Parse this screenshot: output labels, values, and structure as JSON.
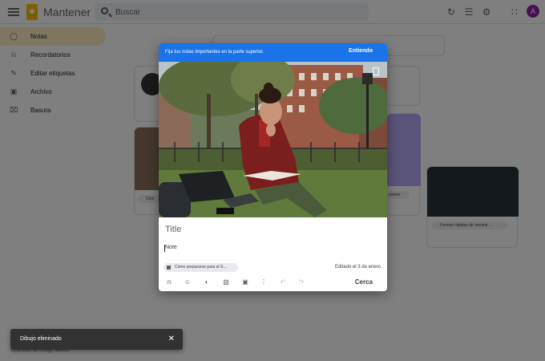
{
  "app": {
    "title": "Mantener",
    "avatar_initial": "A"
  },
  "search": {
    "placeholder": "Buscar"
  },
  "topbar_icons": [
    "refresh-icon",
    "list-view-icon",
    "settings-icon",
    "apps-icon"
  ],
  "sidebar": {
    "items": [
      {
        "label": "Notas",
        "icon": "lightbulb-icon",
        "active": true
      },
      {
        "label": "Recordatorios",
        "icon": "bell-icon",
        "active": false
      },
      {
        "label": "Editar etiquetas",
        "icon": "pencil-icon",
        "active": false
      },
      {
        "label": "Archivo",
        "icon": "archive-icon",
        "active": false
      },
      {
        "label": "Basura",
        "icon": "trash-icon",
        "active": false
      }
    ]
  },
  "background": {
    "chip_left": "Cóm",
    "chip_middle": "ciones",
    "chip_right": "Formas rápidas de resumir ...",
    "licenses": "Licencias de código abierto"
  },
  "modal": {
    "banner_text": "Fija tus notas importantes en la parte superior.",
    "banner_button": "Entiendo",
    "title_placeholder": "Title",
    "note_placeholder": "Note",
    "label_chip": "Cómo prepararse para el S...",
    "edited": "Editado el 3 de enero",
    "close_label": "Cerca",
    "toolbar": [
      "reminder-icon",
      "collaborator-icon",
      "palette-icon",
      "image-icon",
      "archive-icon",
      "more-icon",
      "undo-icon",
      "redo-icon"
    ]
  },
  "snackbar": {
    "text": "Dibujo eliminado"
  }
}
